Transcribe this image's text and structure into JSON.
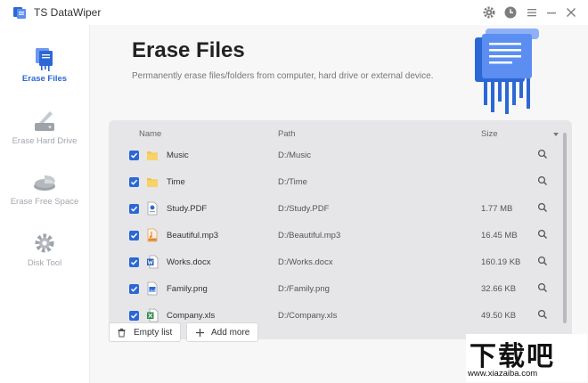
{
  "app": {
    "title": "TS DataWiper"
  },
  "titlebar_icons": [
    "gear-icon",
    "clock-icon",
    "menu-icon",
    "minimize-icon",
    "close-icon"
  ],
  "sidebar": {
    "items": [
      {
        "label": "Erase Files",
        "icon": "erase-files-icon",
        "active": true
      },
      {
        "label": "Erase Hard Drive",
        "icon": "erase-hard-drive-icon",
        "active": false
      },
      {
        "label": "Erase Free Space",
        "icon": "erase-free-space-icon",
        "active": false
      },
      {
        "label": "Disk Tool",
        "icon": "disk-tool-icon",
        "active": false
      }
    ]
  },
  "main": {
    "title": "Erase Files",
    "subtitle": "Permanently erase files/folders from computer, hard drive or external device."
  },
  "table": {
    "columns": {
      "name": "Name",
      "path": "Path",
      "size": "Size"
    },
    "rows": [
      {
        "name": "Music",
        "path": "D:/Music",
        "size": "",
        "type": "folder",
        "checked": true
      },
      {
        "name": "Time",
        "path": "D:/Time",
        "size": "",
        "type": "folder",
        "checked": true
      },
      {
        "name": "Study.PDF",
        "path": "D:/Study.PDF",
        "size": "1.77 MB",
        "type": "pdf",
        "checked": true
      },
      {
        "name": "Beautiful.mp3",
        "path": "D:/Beautiful.mp3",
        "size": "16.45 MB",
        "type": "mp3",
        "checked": true
      },
      {
        "name": "Works.docx",
        "path": "D:/Works.docx",
        "size": "160.19 KB",
        "type": "docx",
        "checked": true
      },
      {
        "name": "Family.png",
        "path": "D:/Family.png",
        "size": "32.66 KB",
        "type": "png",
        "checked": true
      },
      {
        "name": "Company.xls",
        "path": "D:/Company.xls",
        "size": "49.50 KB",
        "type": "xls",
        "checked": true
      }
    ]
  },
  "buttons": {
    "empty_list": "Empty list",
    "add_more": "Add more"
  },
  "watermark": {
    "big": "下载吧",
    "small": "www.xiazaiba.com"
  },
  "colors": {
    "accent": "#2c68d5",
    "folder": "#f4c542",
    "panel": "#e6e6e9"
  }
}
